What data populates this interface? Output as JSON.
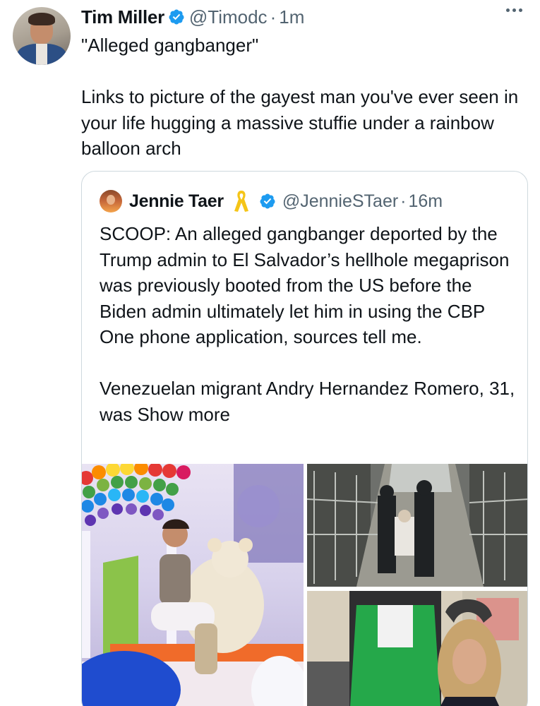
{
  "tweet": {
    "author_name": "Tim Miller",
    "handle": "@Timodc",
    "separator": "·",
    "time": "1m",
    "text": "\"Alleged gangbanger\"\n\nLinks to picture of the gayest man you've ever seen in your life hugging a massive stuffie under a rainbow balloon arch",
    "verified_icon": "verified-badge-icon",
    "more_icon": "more-options-icon"
  },
  "quote": {
    "author_name": "Jennie Taer",
    "ribbon_icon": "yellow-ribbon-icon",
    "handle": "@JennieSTaer",
    "separator": "·",
    "time": "16m",
    "text": "SCOOP: An alleged gangbanger deported by the Trump admin to El Salvador’s hellhole megaprison was previously booted from the US before the Biden admin ultimately let him in using the CBP One phone application, sources tell me.\n\nVenezuelan migrant Andry Hernandez Romero, 31, was ",
    "show_more": "Show more"
  },
  "colors": {
    "verified_blue": "#1d9bf0",
    "secondary_text": "#536471",
    "border": "#cfd9de",
    "ribbon_yellow": "#f5c518"
  }
}
